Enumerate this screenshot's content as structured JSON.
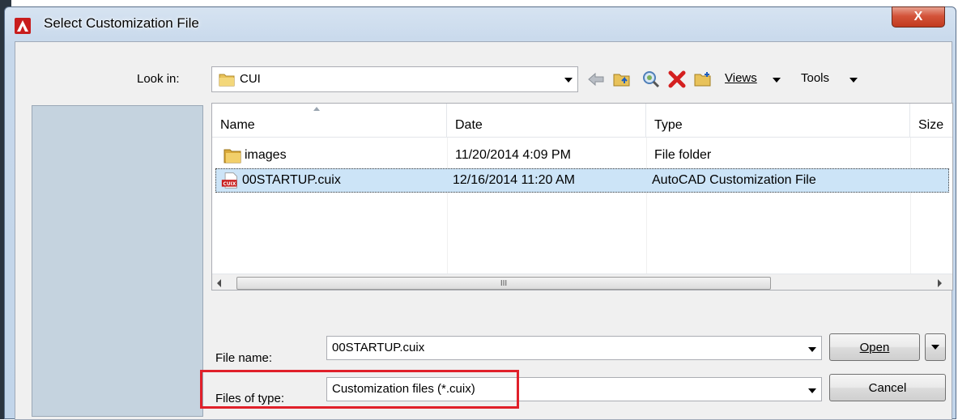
{
  "window": {
    "title": "Select Customization File",
    "close_glyph": "X"
  },
  "look_in": {
    "label": "Look in:",
    "value": "CUI"
  },
  "toolbar": {
    "views_label": "Views",
    "tools_label": "Tools"
  },
  "file_list": {
    "columns": [
      "Name",
      "Date",
      "Type",
      "Size"
    ],
    "rows": [
      {
        "name": "images",
        "date": "11/20/2014 4:09 PM",
        "type": "File folder",
        "icon": "folder-icon",
        "selected": false
      },
      {
        "name": "00STARTUP.cuix",
        "date": "12/16/2014 11:20 AM",
        "type": "AutoCAD Customization File",
        "icon": "cuix-file-icon",
        "selected": true
      }
    ],
    "scroll_thumb_glyph": "III"
  },
  "file_name": {
    "label": "File name:",
    "value": "00STARTUP.cuix"
  },
  "files_of_type": {
    "label": "Files of type:",
    "value": "Customization files (*.cuix)"
  },
  "buttons": {
    "open": "Open",
    "cancel": "Cancel"
  },
  "colors": {
    "selection": "#cce4f7",
    "highlight_box": "#e0202a",
    "close_button": "#c23a1f"
  }
}
